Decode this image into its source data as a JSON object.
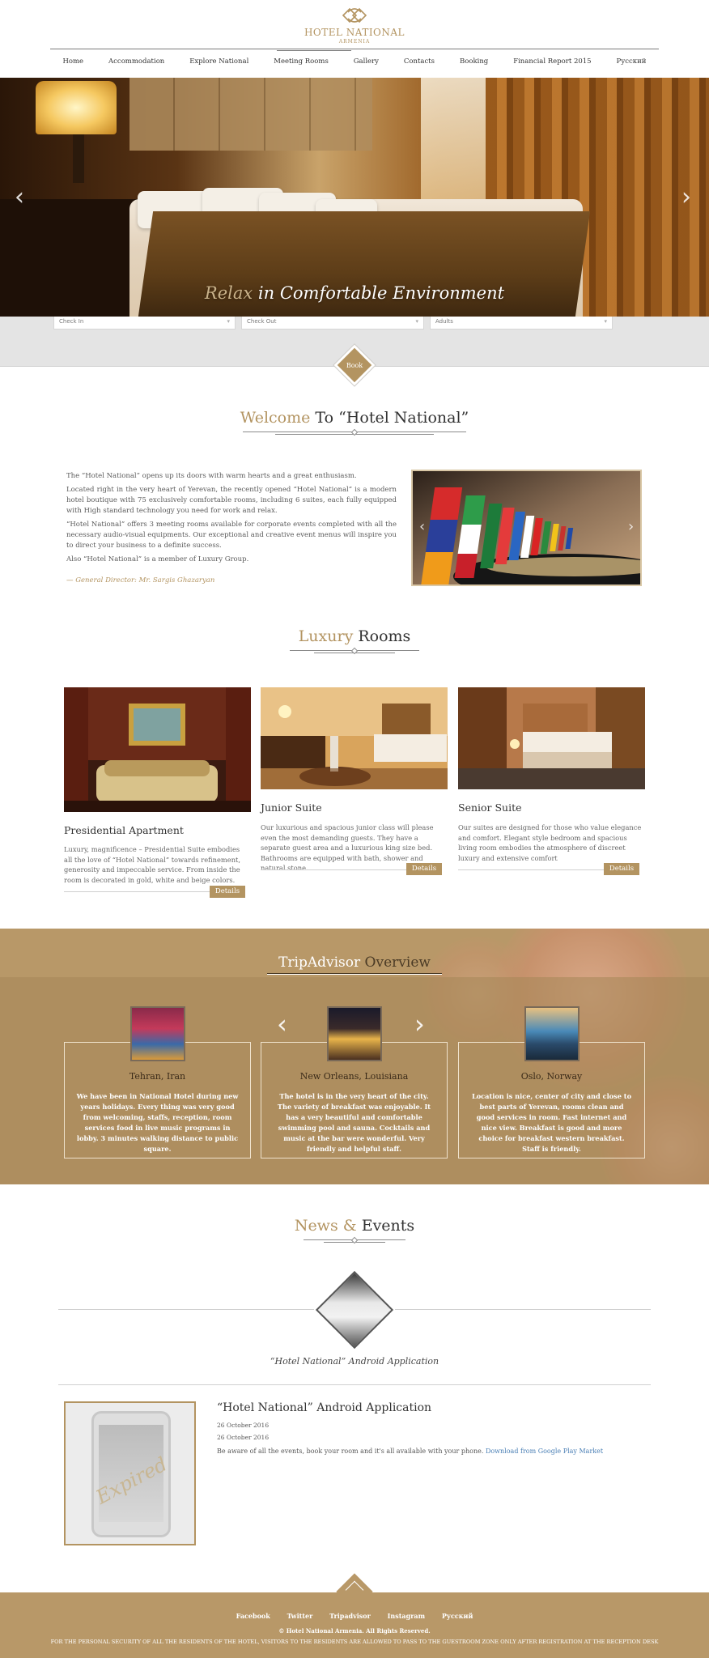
{
  "header": {
    "logo_title": "HOTEL NATIONAL",
    "logo_subtitle": "ARMENIA",
    "nav": [
      "Home",
      "Accommodation",
      "Explore National",
      "Meeting Rooms",
      "Gallery",
      "Contacts",
      "Booking",
      "Financial Report 2015",
      "Русский"
    ]
  },
  "hero": {
    "caption_accent": "Relax",
    "caption_rest": " in Comfortable Environment"
  },
  "booking": {
    "fields": [
      "Check In",
      "Check Out",
      "Adults"
    ],
    "button_label": "Book"
  },
  "welcome": {
    "title_accent": "Welcome",
    "title_rest": " To “Hotel National”",
    "paragraphs": [
      "The “Hotel National” opens up its doors with warm hearts and a great enthusiasm.",
      "Located right in the very heart of Yerevan, the recently opened “Hotel National” is a modern hotel boutique with 75 exclusively comfortable rooms, including 6 suites, each fully equipped with High standard technology you need for work and relax.",
      "“Hotel National” offers 3 meeting rooms available for corporate events completed with all the necessary audio-visual equipments. Our exceptional and creative event menus will inspire you to direct your business to a definite success.",
      "Also “Hotel National” is a member of Luxury Group."
    ],
    "signature": "— General Director: Mr. Sargis Ghazaryan"
  },
  "rooms": {
    "title_accent": "Luxury",
    "title_rest": " Rooms",
    "items": [
      {
        "name": "Presidential Apartment",
        "desc": "Luxury, magnificence – Presidential Suite embodies all the love of “Hotel National” towards refinement, generosity and impeccable service. From inside the room is decorated in gold, white and beige colors.",
        "button": "Details"
      },
      {
        "name": "Junior Suite",
        "desc": "Our luxurious and spacious junior class will please even the most demanding guests. They have a separate guest area and a luxurious king size bed. Bathrooms are equipped with bath, shower and natural stone.",
        "button": "Details"
      },
      {
        "name": "Senior Suite",
        "desc": "Our suites are designed for those who value elegance and comfort. Elegant style bedroom and spacious living room embodies the atmosphere of discreet luxury and extensive comfort",
        "button": "Details"
      }
    ]
  },
  "tripadvisor": {
    "title_light": "TripAdvisor",
    "title_dark": " Overview",
    "reviews": [
      {
        "city": "Tehran, Iran",
        "text": "We have been in National Hotel during new years holidays. Every thing was very good from welcoming, staffs, reception, room services food in live music programs in lobby. 3 minutes walking distance to public square."
      },
      {
        "city": "New Orleans, Louisiana",
        "text": "The hotel is in the very heart of the city. The variety of breakfast was enjoyable. It has a very beautiful and comfortable swimming pool and sauna. Cocktails and music at the bar were wonderful. Very friendly and helpful staff."
      },
      {
        "city": "Oslo, Norway",
        "text": "Location is nice, center of city and close to best parts of Yerevan, rooms clean and good services in room. Fast internet and nice view. Breakfast is good and more choice for breakfast western breakfast. Staff is friendly."
      }
    ]
  },
  "news": {
    "title_accent": "News",
    "title_amp": " & ",
    "title_rest": "Events",
    "featured_caption": "“Hotel National” Android Application",
    "item": {
      "title": "“Hotel National” Android Application",
      "date1": "26 October 2016",
      "date2": "26 October 2016",
      "body": "Be aware of all the events, book your room and it's all available with your phone. ",
      "link": "Download from Google Play Market",
      "badge": "Expired"
    }
  },
  "footer": {
    "links": [
      "Facebook",
      "Twitter",
      "Tripadvisor",
      "Instagram",
      "Русский"
    ],
    "copyright": "© Hotel National Armenia. All Rights Reserved.",
    "notice": "FOR THE PERSONAL SECURITY OF ALL THE RESIDENTS OF THE HOTEL, VISITORS TO THE RESIDENTS ARE ALLOWED TO PASS TO THE GUESTROOM ZONE ONLY AFTER REGISTRATION AT THE RECEPTION DESK"
  },
  "colors": {
    "accent": "#b39461",
    "footer_bg": "#b89868",
    "booking_bar": "#e4e4e4"
  }
}
